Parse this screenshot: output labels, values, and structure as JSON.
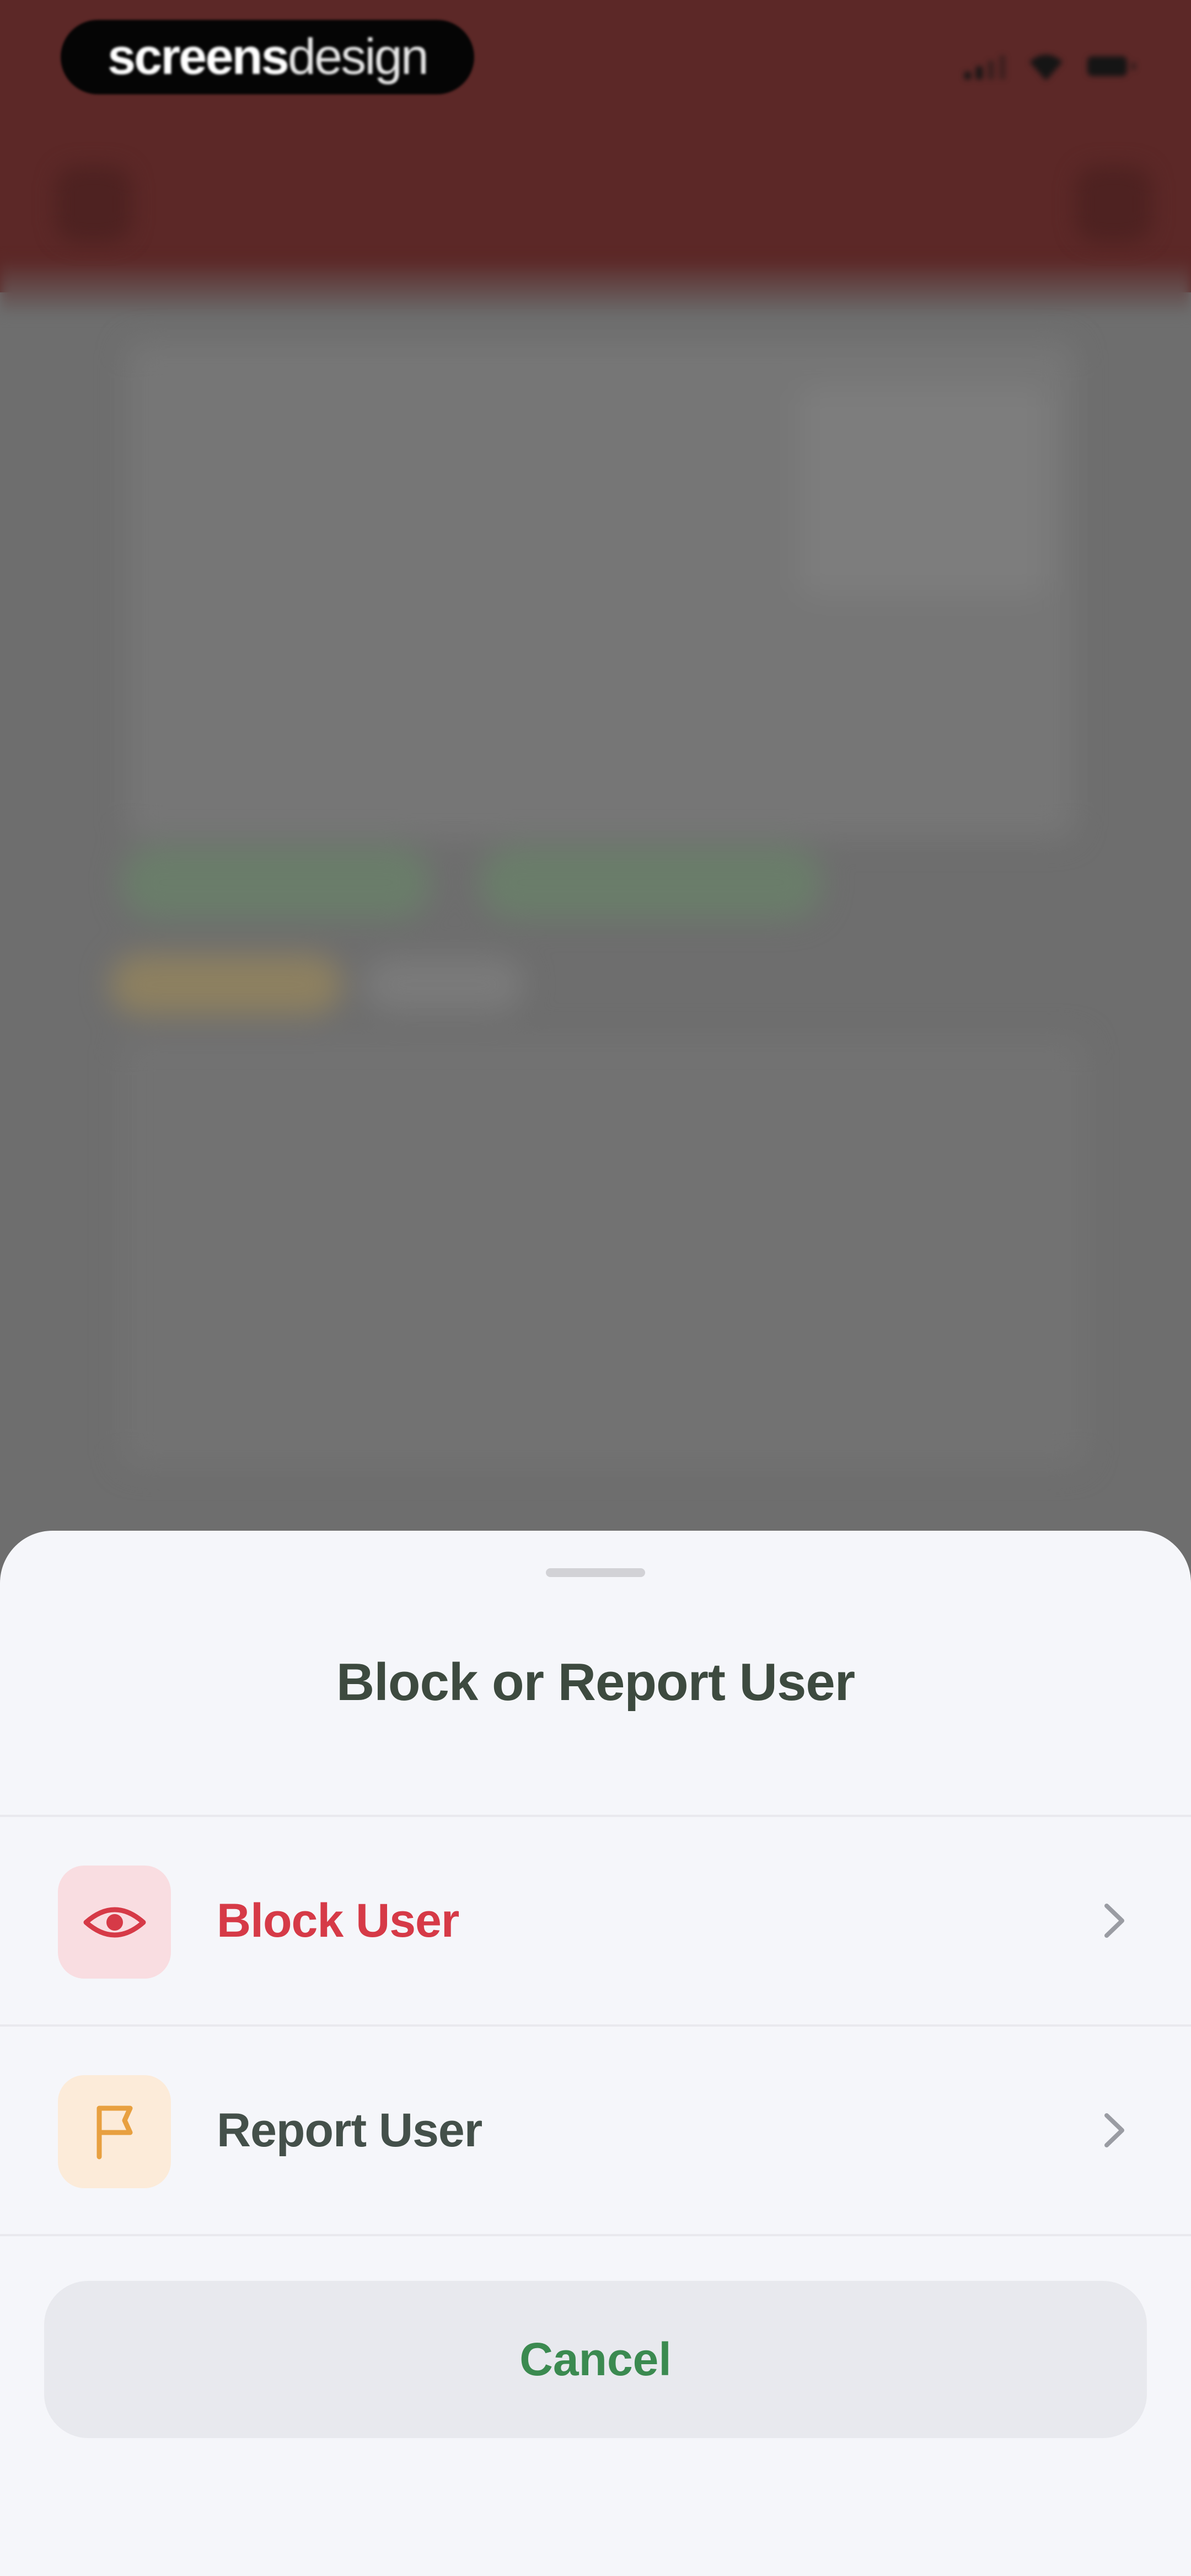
{
  "watermark": {
    "bold": "screens",
    "light": "design"
  },
  "sheet": {
    "title": "Block or Report User",
    "options": [
      {
        "label": "Block User",
        "icon": "eye-icon",
        "color": "#d63a47",
        "icon_bg": "#f9dde1"
      },
      {
        "label": "Report User",
        "icon": "flag-icon",
        "color": "#44504a",
        "icon_bg": "#fcebd9"
      }
    ],
    "cancel_label": "Cancel"
  },
  "colors": {
    "header": "#5c2827",
    "overlay": "#6e6e6e",
    "sheet_bg": "#f5f6fa",
    "accent_green": "#3b8a50",
    "danger": "#d63a47",
    "warning": "#e8a040"
  }
}
